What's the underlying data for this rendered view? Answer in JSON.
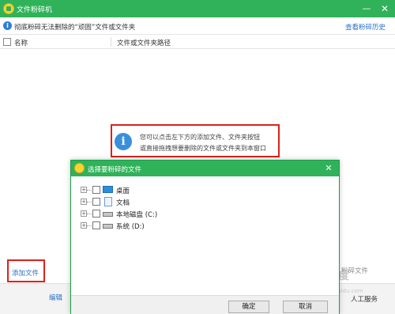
{
  "window": {
    "title": "文件粉碎机",
    "minimize_glyph": "—",
    "close_glyph": "✕"
  },
  "infobar": {
    "icon": "info-icon",
    "text": "彻底粉碎无法删除的“顽固”文件或文件夹",
    "history_link": "查看粉碎历史"
  },
  "table": {
    "columns": [
      "名称",
      "文件或文件夹路径"
    ]
  },
  "hint": {
    "icon_glyph": "i",
    "line1": "您可以点击左下方的添加文件、文件夹按钮",
    "line2": "或直接拖拽想要删除的文件或文件夹到本窗口"
  },
  "footer": {
    "add_file": "添加文件",
    "shred": "粉碎文件",
    "edit": "编辑",
    "service": "人工服务"
  },
  "dialog": {
    "title": "选择要粉碎的文件",
    "close_glyph": "✕",
    "tree": [
      {
        "label": "桌面",
        "icon": "desktop-icon"
      },
      {
        "label": "文档",
        "icon": "document-icon"
      },
      {
        "label": "本地磁盘 (C:)",
        "icon": "drive-icon"
      },
      {
        "label": "系统 (D:)",
        "icon": "drive-icon"
      }
    ],
    "ok": "确定",
    "cancel": "取消"
  },
  "watermark": {
    "text": "Bai 百度",
    "sub": "jingyan.baidu.com"
  },
  "colors": {
    "titlebar": "#2fb25a",
    "link": "#2670c7",
    "highlight_border": "#e0201b",
    "info_blue": "#3a8fdc"
  }
}
